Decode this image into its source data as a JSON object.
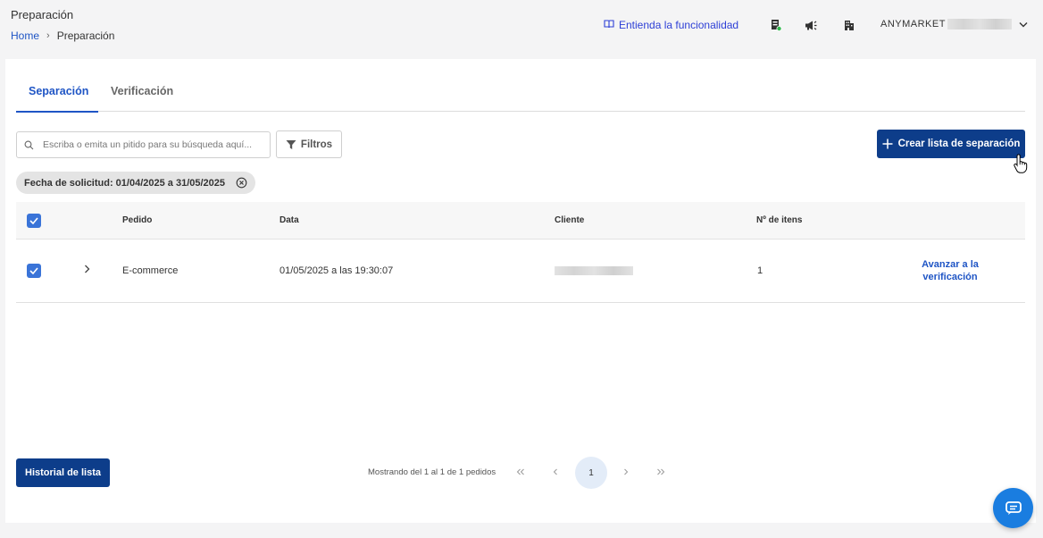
{
  "header": {
    "title": "Preparación",
    "breadcrumb": {
      "home": "Home",
      "separator": "›",
      "current": "Preparación"
    },
    "help_link": "Entienda la funcionalidad",
    "icons": [
      "store-status-icon",
      "megaphone-icon",
      "building-icon"
    ],
    "account": {
      "name": "ANYMARKET"
    }
  },
  "tabs": [
    {
      "label": "Separación",
      "active": true
    },
    {
      "label": "Verificación",
      "active": false
    }
  ],
  "search": {
    "placeholder": "Escriba o emita un pitido para su búsqueda aquí...",
    "value": ""
  },
  "filter_button": "Filtros",
  "create_button": "Crear lista de separación",
  "active_filter": "Fecha de solicitud: 01/04/2025 a 31/05/2025",
  "table": {
    "columns": [
      "Pedido",
      "Data",
      "Cliente",
      "Nº de itens"
    ],
    "rows": [
      {
        "checked": true,
        "pedido": "E-commerce",
        "data": "01/05/2025 a las 19:30:07",
        "cliente": "",
        "itens": "1",
        "action": "Avanzar a la verificación"
      }
    ]
  },
  "history_button": "Historial de lista",
  "pagination": {
    "info": "Mostrando del 1 al 1 de 1 pedidos",
    "current_page": "1"
  },
  "colors": {
    "primary": "#0d3d8a",
    "link": "#1f55c5",
    "checkbox": "#3a74d8",
    "chat": "#1a7de0"
  }
}
